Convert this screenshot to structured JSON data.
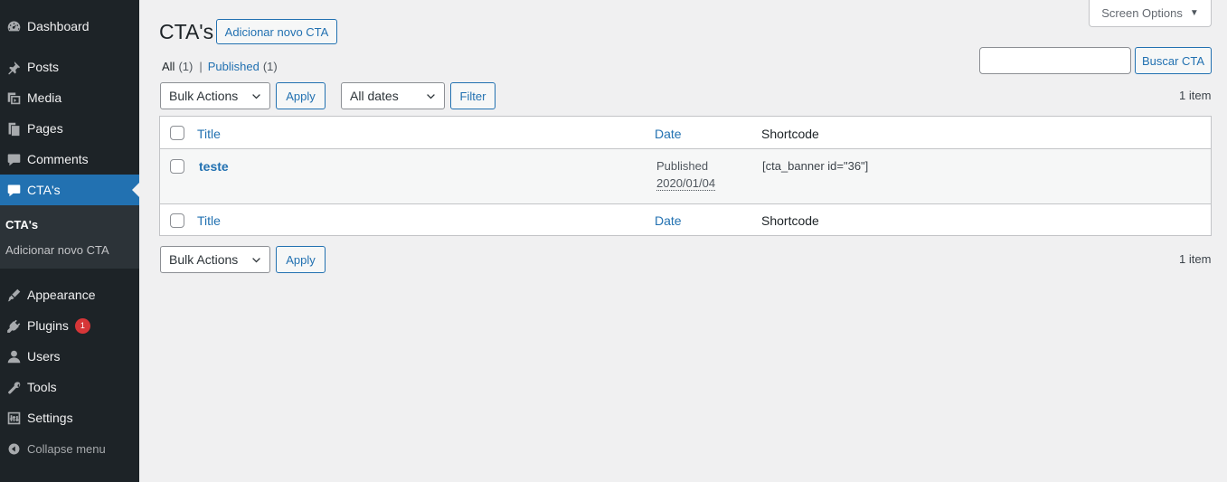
{
  "sidebar": {
    "items": [
      {
        "label": "Dashboard",
        "icon": "dashboard-icon"
      },
      {
        "label": "Posts",
        "icon": "pushpin-icon"
      },
      {
        "label": "Media",
        "icon": "media-icon"
      },
      {
        "label": "Pages",
        "icon": "pages-icon"
      },
      {
        "label": "Comments",
        "icon": "comment-icon"
      },
      {
        "label": "CTA's",
        "icon": "comment-icon"
      },
      {
        "label": "Appearance",
        "icon": "brush-icon"
      },
      {
        "label": "Plugins",
        "icon": "plugin-icon",
        "badge": "1"
      },
      {
        "label": "Users",
        "icon": "user-icon"
      },
      {
        "label": "Tools",
        "icon": "wrench-icon"
      },
      {
        "label": "Settings",
        "icon": "settings-icon"
      }
    ],
    "submenu": [
      "CTA's",
      "Adicionar novo CTA"
    ],
    "collapse_label": "Collapse menu"
  },
  "header": {
    "screen_options": "Screen Options",
    "title": "CTA's",
    "add_new": "Adicionar novo CTA"
  },
  "views": {
    "all_label": "All",
    "all_count": "(1)",
    "separator": "|",
    "published_label": "Published",
    "published_count": "(1)"
  },
  "search": {
    "value": "",
    "button": "Buscar CTA"
  },
  "tablenav_top": {
    "bulk_actions": "Bulk Actions",
    "apply": "Apply",
    "dates": "All dates",
    "filter": "Filter",
    "items": "1 item"
  },
  "table": {
    "columns": [
      "Title",
      "Date",
      "Shortcode"
    ],
    "rows": [
      {
        "title": "teste",
        "status": "Published",
        "date": "2020/01/04",
        "shortcode": "[cta_banner id=\"36\"]"
      }
    ]
  },
  "tablenav_bottom": {
    "bulk_actions": "Bulk Actions",
    "apply": "Apply",
    "items": "1 item"
  },
  "colors": {
    "sidebar_bg": "#1d2327",
    "accent": "#2271b1",
    "badge": "#d63638",
    "page_bg": "#f0f0f1"
  }
}
